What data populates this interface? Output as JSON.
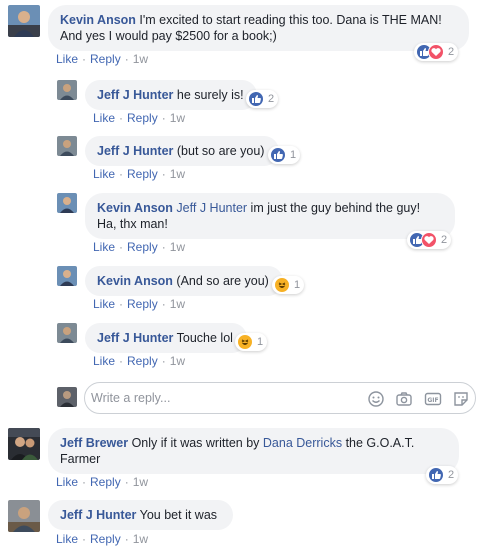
{
  "actions": {
    "like": "Like",
    "reply": "Reply",
    "dot": "·"
  },
  "comments": [
    {
      "author": "Kevin Anson",
      "text": "I'm excited to start reading this too. Dana is THE MAN! And yes I would pay $2500 for a book;)",
      "time": "1w",
      "reaction_count": "2",
      "reactions": [
        "like",
        "love"
      ]
    },
    {
      "author": "Jeff J Hunter",
      "text": "he surely is!",
      "time": "1w",
      "reaction_count": "2",
      "reactions": [
        "like"
      ]
    },
    {
      "author": "Jeff J Hunter",
      "text": "(but so are you)",
      "time": "1w",
      "reaction_count": "1",
      "reactions": [
        "like"
      ]
    },
    {
      "author": "Kevin Anson",
      "mention": "Jeff J Hunter",
      "text": "im just the guy behind the guy! Ha, thx man!",
      "time": "1w",
      "reaction_count": "2",
      "reactions": [
        "like",
        "love"
      ]
    },
    {
      "author": "Kevin Anson",
      "text": "(And so are you)",
      "time": "1w",
      "reaction_count": "1",
      "reactions": [
        "haha"
      ]
    },
    {
      "author": "Jeff J Hunter",
      "text": "Touche lol",
      "time": "1w",
      "reaction_count": "1",
      "reactions": [
        "haha"
      ]
    },
    {
      "author": "Jeff Brewer",
      "text_before": "Only if it was written by",
      "mention": "Dana Derricks",
      "text_after": "the G.O.A.T. Farmer",
      "time": "1w",
      "reaction_count": "2",
      "reactions": [
        "like"
      ]
    },
    {
      "author": "Jeff J Hunter",
      "text": "You bet it was",
      "time": "1w"
    }
  ],
  "reply_box": {
    "placeholder": "Write a reply...",
    "icons": [
      "emoji-icon",
      "camera-icon",
      "gif-icon",
      "sticker-icon"
    ]
  },
  "colors": {
    "link": "#385898",
    "action": "#4267b2",
    "bubble": "#f2f3f5",
    "like": "#4267b2",
    "love": "#f25268",
    "haha": "#f7b125"
  }
}
